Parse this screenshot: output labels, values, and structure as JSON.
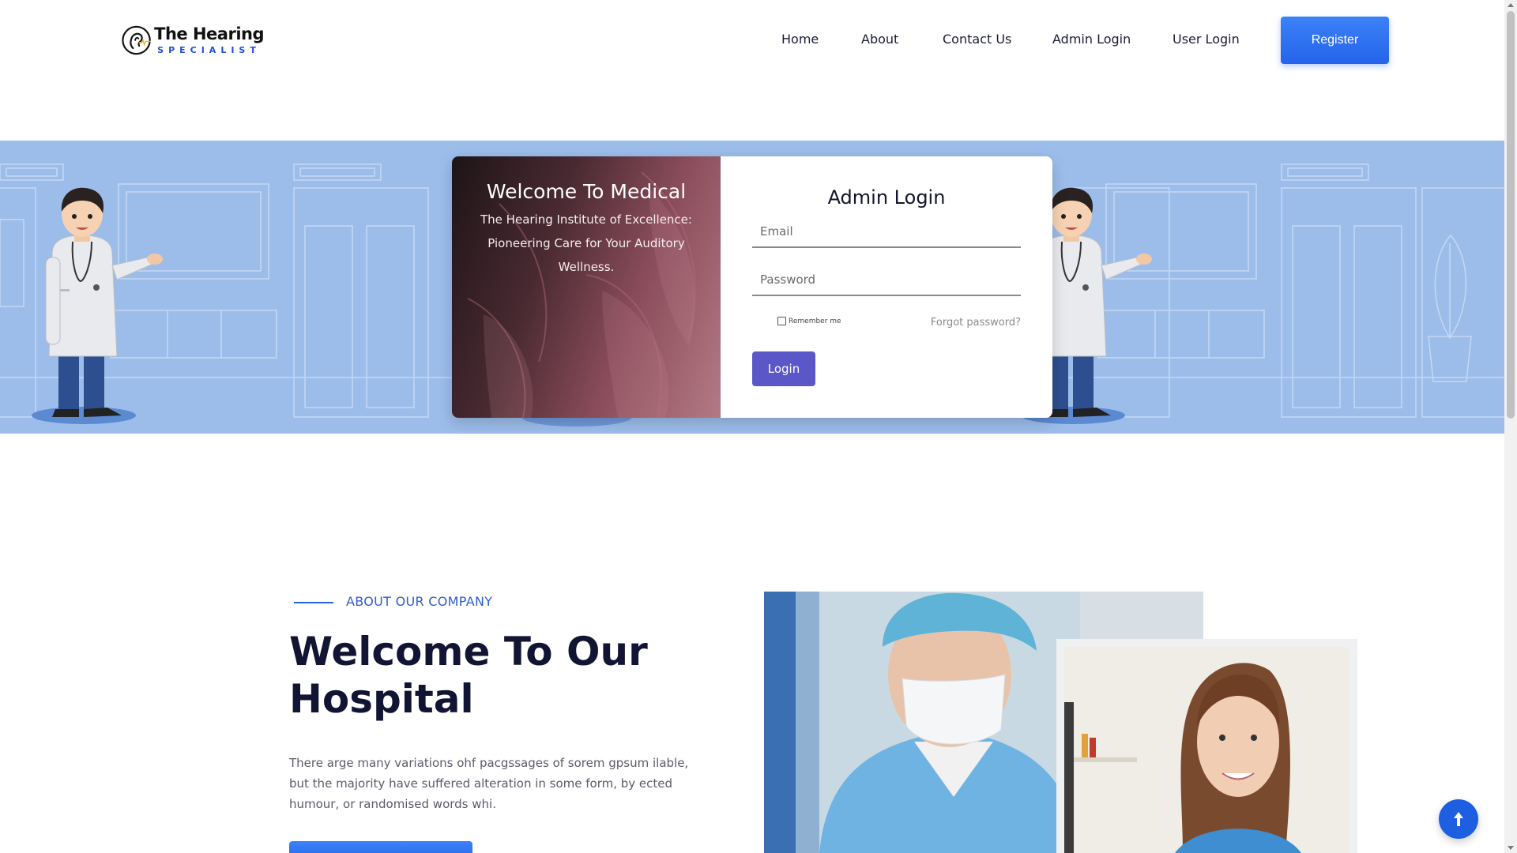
{
  "header": {
    "logo": {
      "title": "The Hearing",
      "subtitle": "SPECIALIST"
    },
    "nav": {
      "home": "Home",
      "about": "About",
      "contact": "Contact Us",
      "admin_login": "Admin Login",
      "user_login": "User Login"
    },
    "register_label": "Register"
  },
  "hero": {
    "welcome_title": "Welcome To Medical",
    "welcome_text": "The Hearing Institute of Excellence: Pioneering Care for Your Auditory Wellness.",
    "login_title": "Admin Login",
    "email_placeholder": "Email",
    "password_placeholder": "Password",
    "remember_label": "Remember me",
    "forgot_label": "Forgot password?",
    "login_button": "Login"
  },
  "about": {
    "kicker": "ABOUT OUR COMPANY",
    "title": "Welcome To Our Hospital",
    "text": "There arge many variations ohf pacgssages of sorem gpsum ilable, but the majority have suffered alteration in some form, by ected humour, or randomised words whi."
  },
  "colors": {
    "accent": "#2563eb",
    "hero_bg": "#9cbdea",
    "login_button": "#5b57c9",
    "heading": "#121433"
  },
  "icons": {
    "logo": "ear-logo-icon",
    "scroll_top": "arrow-up-icon"
  }
}
